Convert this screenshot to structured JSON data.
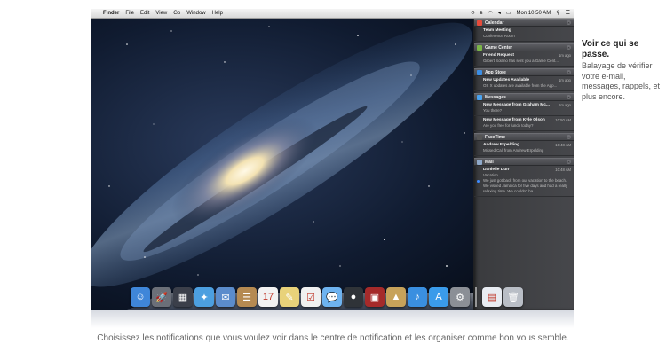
{
  "menubar": {
    "items": [
      "Finder",
      "File",
      "Edit",
      "View",
      "Go",
      "Window",
      "Help"
    ],
    "clock": "Mon 10:50 AM"
  },
  "notification_center": {
    "sections": [
      {
        "app": "Calendar",
        "icon_color": "#e64b3b",
        "items": [
          {
            "title": "Team Meeting",
            "time": "",
            "body": "Conference Room",
            "unread": false
          }
        ]
      },
      {
        "app": "Game Center",
        "icon_color": "#7bb648",
        "items": [
          {
            "title": "Friend Request",
            "time": "1m ago",
            "body": "Gilbert Solano has sent you a Game Cent...",
            "unread": false
          }
        ]
      },
      {
        "app": "App Store",
        "icon_color": "#3a8ee6",
        "items": [
          {
            "title": "New Updates Available",
            "time": "1m ago",
            "body": "OS X updates are available from the App...",
            "unread": false
          }
        ]
      },
      {
        "app": "Messages",
        "icon_color": "#4aa3f0",
        "items": [
          {
            "title": "New Message from Graham Mc...",
            "time": "1m ago",
            "body": "You there?",
            "unread": false
          },
          {
            "title": "New Message from Kyle Olson",
            "time": "10:50 AM",
            "body": "Are you free for lunch today?",
            "unread": false
          }
        ]
      },
      {
        "app": "FaceTime",
        "icon_color": "#555555",
        "items": [
          {
            "title": "Andrew Erpelding",
            "time": "10:48 AM",
            "body": "Missed Call from Andrew Erpelding",
            "unread": false
          }
        ]
      },
      {
        "app": "Mail",
        "icon_color": "#8fa9c9",
        "items": [
          {
            "title": "Danielle Durr",
            "time": "10:48 AM",
            "body": "Vacation\nWe just got back from our vacation to the beach. We visited Jamaica for five days and had a really relaxing time. We couldn't ha...",
            "unread": true
          }
        ]
      }
    ]
  },
  "dock": {
    "icons": [
      {
        "name": "finder-icon",
        "glyph": "☺",
        "color": "#3f86d9"
      },
      {
        "name": "launchpad-icon",
        "glyph": "🚀",
        "color": "#6b6f78"
      },
      {
        "name": "mission-control-icon",
        "glyph": "▦",
        "color": "#3b3f4a"
      },
      {
        "name": "safari-icon",
        "glyph": "✦",
        "color": "#4c9fe0"
      },
      {
        "name": "mail-stamp-icon",
        "glyph": "✉",
        "color": "#5b8ccc"
      },
      {
        "name": "contacts-icon",
        "glyph": "☰",
        "color": "#b58a52"
      },
      {
        "name": "calendar-icon",
        "glyph": "17",
        "color": "#f2f2f2"
      },
      {
        "name": "notes-icon",
        "glyph": "✎",
        "color": "#e8d27a"
      },
      {
        "name": "reminders-icon",
        "glyph": "☑",
        "color": "#f0f0f0"
      },
      {
        "name": "messages-icon",
        "glyph": "💬",
        "color": "#6eb3f0"
      },
      {
        "name": "facetime-icon",
        "glyph": "●",
        "color": "#2f3338"
      },
      {
        "name": "photo-booth-icon",
        "glyph": "▣",
        "color": "#a52a2a"
      },
      {
        "name": "iphoto-icon",
        "glyph": "▲",
        "color": "#c7a25a"
      },
      {
        "name": "itunes-icon",
        "glyph": "♪",
        "color": "#3a8fe0"
      },
      {
        "name": "app-store-icon",
        "glyph": "A",
        "color": "#3a9bea"
      },
      {
        "name": "system-preferences-icon",
        "glyph": "⚙",
        "color": "#8b8f96"
      },
      {
        "name": "document-icon",
        "glyph": "▤",
        "color": "#e8ecf2"
      },
      {
        "name": "trash-icon",
        "glyph": "🗑",
        "color": "#b9bec6"
      }
    ]
  },
  "callout": {
    "title": "Voir ce qui se passe.",
    "text": "Balayage de vérifier votre e-mail, messages, rappels, et plus encore."
  },
  "caption": "Choisissez les notifications que vous voulez voir dans le centre de notification et les organiser comme bon vous semble."
}
